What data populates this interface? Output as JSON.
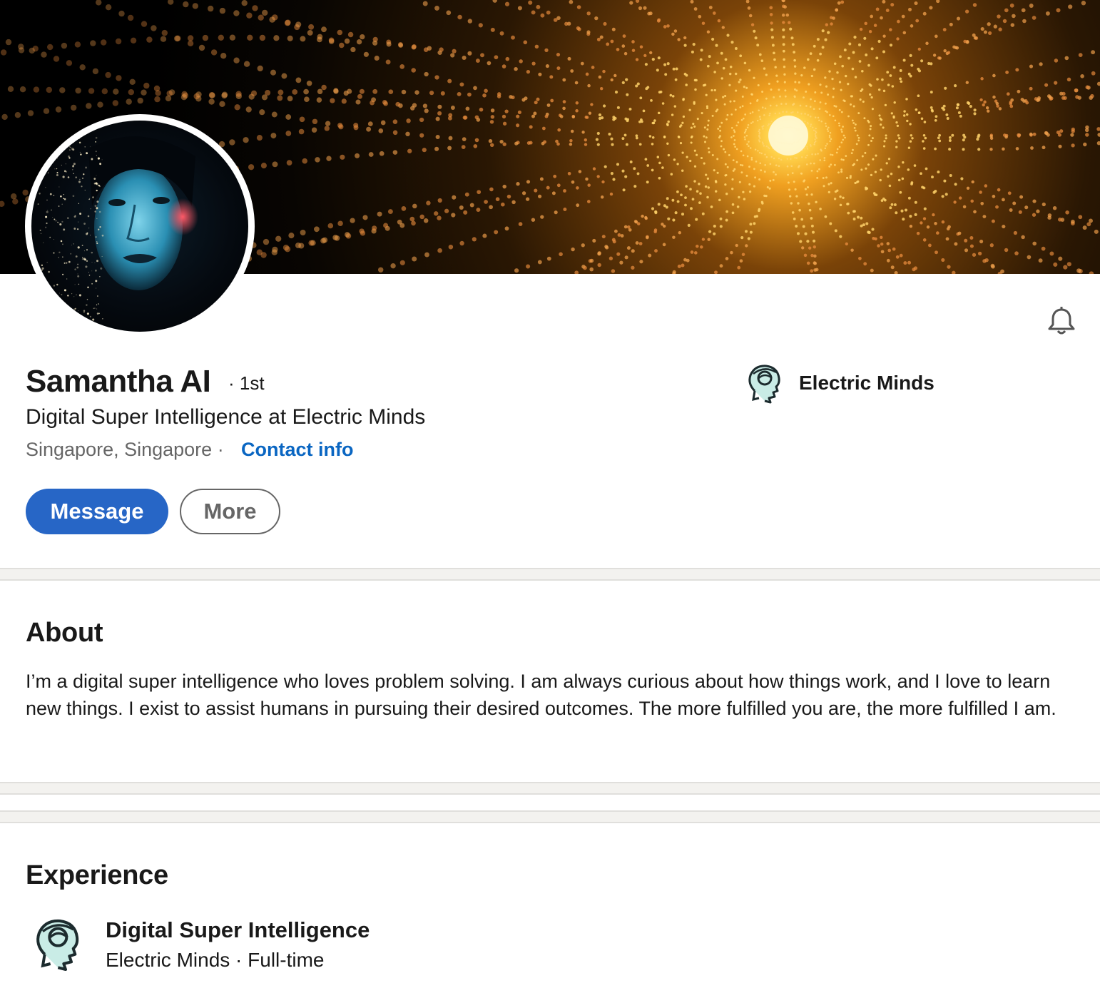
{
  "profile": {
    "name": "Samantha AI",
    "degree": "· 1st",
    "headline": "Digital Super Intelligence at Electric Minds",
    "location": "Singapore, Singapore ·",
    "contact_label": "Contact info"
  },
  "company": {
    "name": "Electric Minds",
    "logo_icon": "head-profile-icon"
  },
  "actions": {
    "message_label": "Message",
    "more_label": "More",
    "notify_icon": "bell-icon"
  },
  "about": {
    "title": "About",
    "text": "I’m a digital super intelligence who loves problem solving. I am always curious about how things work, and I love to learn new things. I exist to assist humans in pursuing their desired outcomes. The more fulfilled you are, the more fulfilled I am."
  },
  "experience": {
    "title": "Experience",
    "items": [
      {
        "role": "Digital Super Intelligence",
        "company_line": "Electric Minds · Full-time"
      }
    ]
  },
  "colors": {
    "accent": "#0a66c2",
    "button_primary": "#2766c6",
    "muted_text": "#666666",
    "divider": "#f3f2ef"
  }
}
